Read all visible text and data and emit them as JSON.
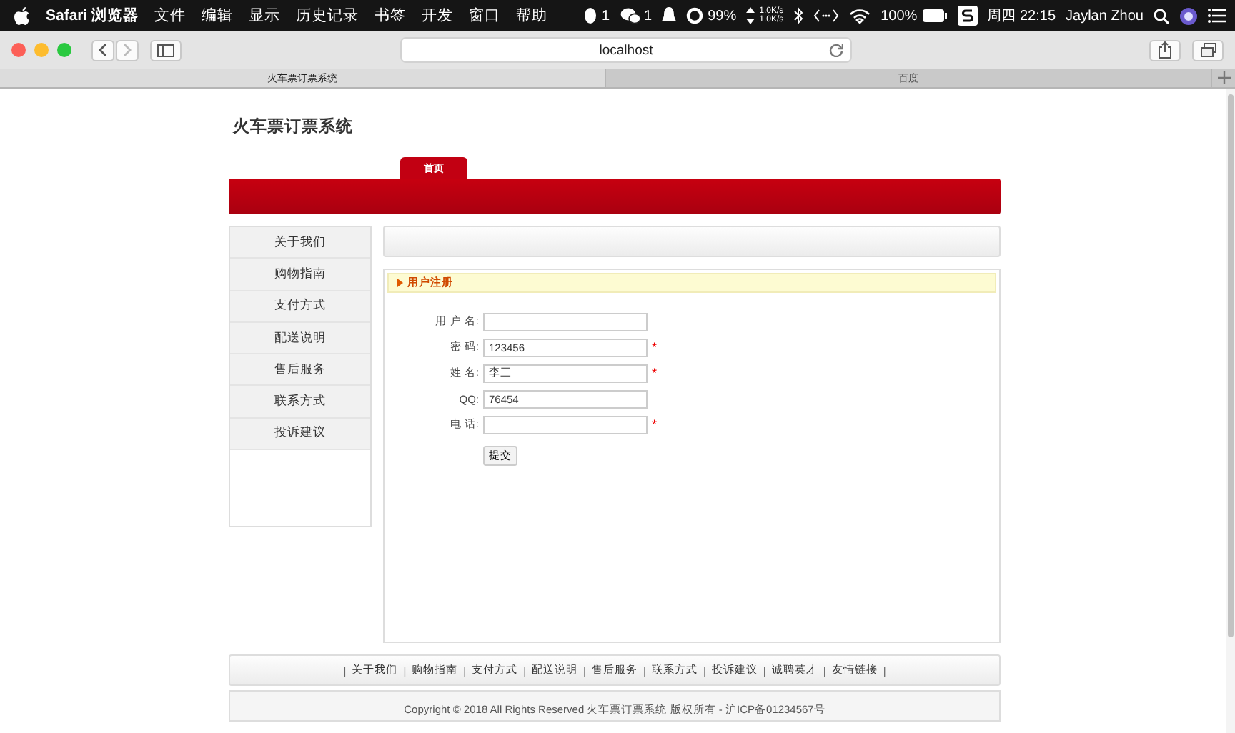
{
  "menu_bar": {
    "app": "Safari 浏览器",
    "menus": [
      "文件",
      "编辑",
      "显示",
      "历史记录",
      "书签",
      "开发",
      "窗口",
      "帮助"
    ],
    "status": [
      {
        "kind": "qq",
        "text": "1"
      },
      {
        "kind": "wechat",
        "text": "1"
      },
      {
        "kind": "bell"
      },
      {
        "kind": "ring",
        "text": "99%"
      },
      {
        "kind": "net",
        "text": "1.0K/s",
        "text2": "1.0K/s"
      },
      {
        "kind": "bluetooth"
      },
      {
        "kind": "code"
      },
      {
        "kind": "wifi"
      },
      {
        "kind": "battery",
        "text": "100%"
      },
      {
        "kind": "s"
      }
    ],
    "clock": "周四 22:15",
    "user": "Jaylan Zhou"
  },
  "browser": {
    "address": "localhost",
    "tabs": [
      {
        "label": "火车票订票系统",
        "selected": true
      },
      {
        "label": "百度",
        "selected": false
      }
    ]
  },
  "page": {
    "site_title": "火车票订票系统",
    "nav": [
      {
        "label": "首页",
        "selected": true
      }
    ],
    "sidebar": [
      {
        "label": "关于我们"
      },
      {
        "label": "购物指南"
      },
      {
        "label": "支付方式"
      },
      {
        "label": "配送说明"
      },
      {
        "label": "售后服务"
      },
      {
        "label": "联系方式"
      },
      {
        "label": "投诉建议"
      }
    ],
    "form": {
      "title": "用户注册",
      "required_mark": "*",
      "fields": [
        {
          "label": "用 户 名:",
          "required": false
        },
        {
          "label": "密 码:",
          "value": "123456",
          "required": true
        },
        {
          "label": "姓 名:",
          "value": "李三",
          "required": true
        },
        {
          "label": "QQ:",
          "value": "76454",
          "required": false
        },
        {
          "label": "电 话:",
          "required": true
        }
      ],
      "submit": "提交"
    },
    "footer_separator": "|",
    "footer_links": [
      "关于我们",
      "购物指南",
      "支付方式",
      "配送说明",
      "售后服务",
      "联系方式",
      "投诉建议",
      "诚聘英才",
      "友情链接"
    ],
    "copyright": "Copyright © 2018 All Rights Reserved 火车票订票系统 版权所有 - 沪ICP备01234567号"
  }
}
